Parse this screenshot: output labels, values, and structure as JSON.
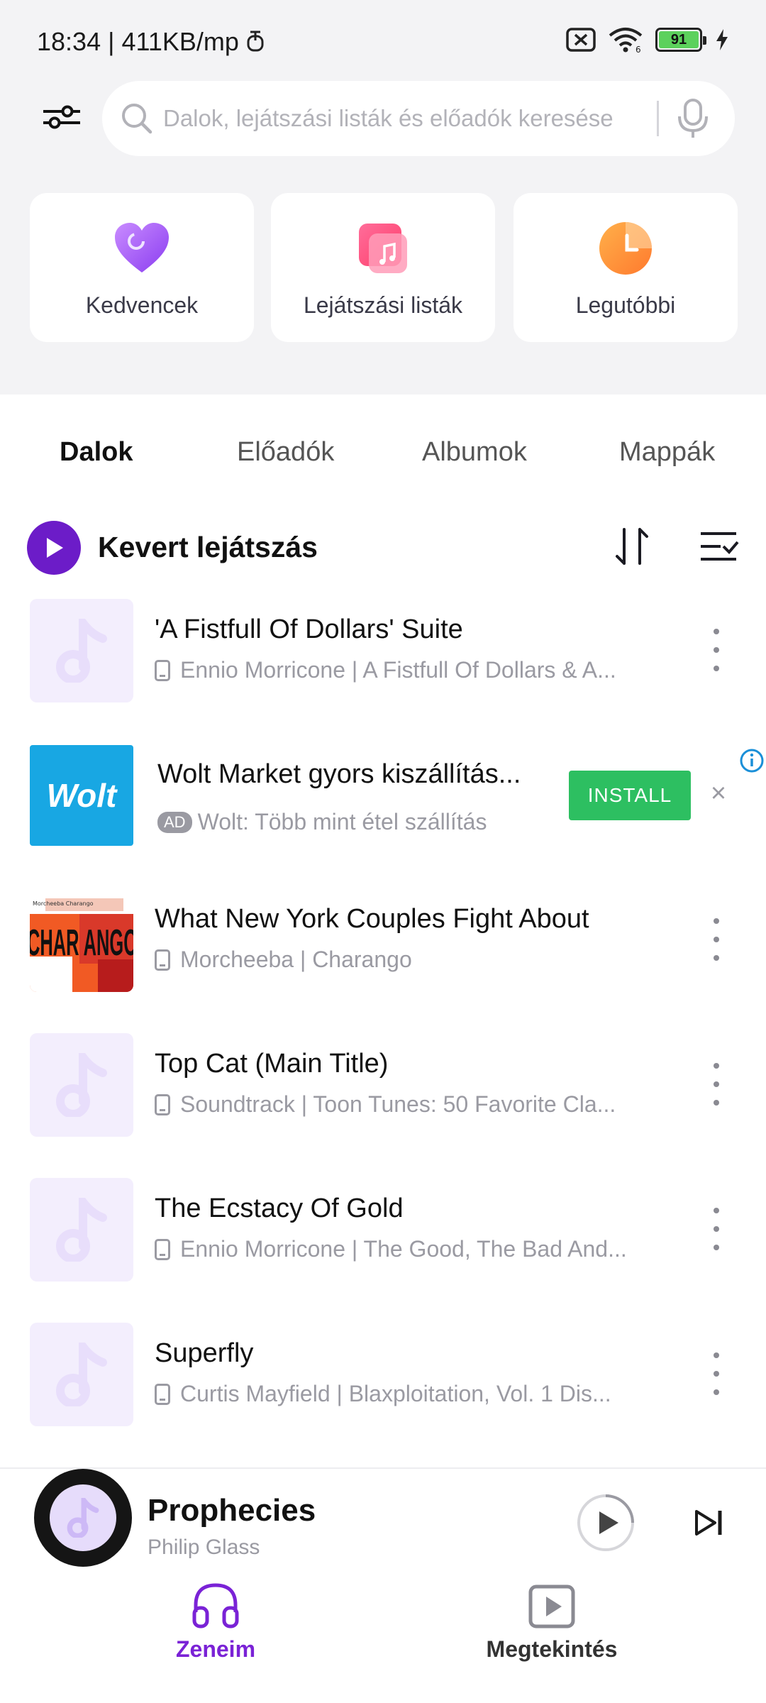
{
  "status_bar": {
    "time_speed": "18:34 | 411KB/mp",
    "battery": "91"
  },
  "search": {
    "placeholder": "Dalok, lejátszási listák és előadók keresése"
  },
  "quick_access": [
    {
      "label": "Kedvencek",
      "icon": "heart-icon"
    },
    {
      "label": "Lejátszási listák",
      "icon": "playlist-icon"
    },
    {
      "label": "Legutóbbi",
      "icon": "clock-icon"
    }
  ],
  "tabs": [
    "Dalok",
    "Előadók",
    "Albumok",
    "Mappák"
  ],
  "active_tab": "Dalok",
  "shuffle": {
    "label": "Kevert lejátszás"
  },
  "songs": [
    {
      "title": "'A Fistfull Of Dollars' Suite",
      "subtitle": "Ennio Morricone | A Fistfull Of Dollars & A..."
    },
    {
      "title": "What New York Couples Fight About",
      "subtitle": "Morcheeba | Charango"
    },
    {
      "title": "Top Cat (Main Title)",
      "subtitle": "Soundtrack | Toon Tunes: 50 Favorite Cla..."
    },
    {
      "title": "The Ecstacy Of Gold",
      "subtitle": "Ennio Morricone | The Good, The Bad And..."
    },
    {
      "title": "Superfly",
      "subtitle": "Curtis Mayfield | Blaxploitation, Vol. 1 Dis..."
    }
  ],
  "ad": {
    "logo_text": "Wolt",
    "title": "Wolt Market gyors kiszállítás...",
    "badge": "AD",
    "subtitle": "Wolt: Több mint étel szállítás",
    "install": "INSTALL"
  },
  "album_art": {
    "small_text": "Morcheeba Charango",
    "big_text": "CHAR ANGO"
  },
  "now_playing": {
    "title": "Prophecies",
    "artist": "Philip Glass"
  },
  "bottom_nav": [
    {
      "label": "Zeneim",
      "active": true
    },
    {
      "label": "Megtekintés",
      "active": false
    }
  ],
  "colors": {
    "accent": "#6c1cc8",
    "accent_light": "#9b5cf0",
    "install_green": "#2dbf61",
    "wolt_blue": "#18a7e3"
  }
}
